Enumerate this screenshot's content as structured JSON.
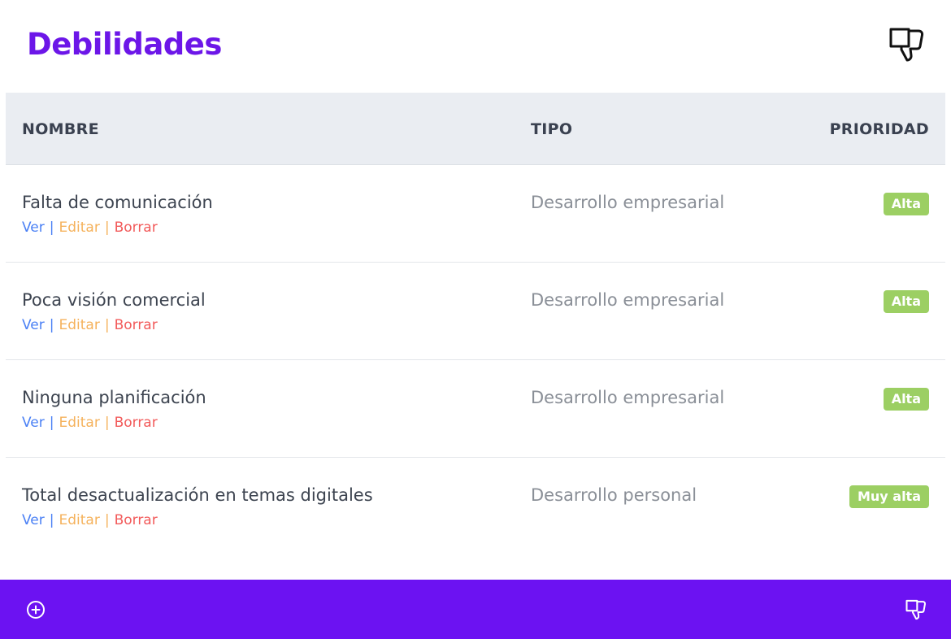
{
  "panel": {
    "title": "Debilidades",
    "header_icon": "thumbs-down-icon"
  },
  "table": {
    "columns": {
      "name": "NOMBRE",
      "type": "TIPO",
      "priority": "PRIORIDAD"
    },
    "rows": [
      {
        "name": "Falta de comunicación",
        "type": "Desarrollo empresarial",
        "priority": "Alta"
      },
      {
        "name": "Poca visión comercial",
        "type": "Desarrollo empresarial",
        "priority": "Alta"
      },
      {
        "name": "Ninguna planificación",
        "type": "Desarrollo empresarial",
        "priority": "Alta"
      },
      {
        "name": "Total desactualización en temas digitales",
        "type": "Desarrollo personal",
        "priority": "Muy alta"
      }
    ],
    "actions": {
      "view": "Ver",
      "edit": "Editar",
      "delete": "Borrar",
      "separator": "|"
    }
  },
  "footer": {
    "add_icon": "plus-circle-icon",
    "thumb_icon": "thumbs-down-icon"
  },
  "colors": {
    "accent": "#6c16e8",
    "footer_bg": "#6c12f2",
    "header_row_bg": "#eaedf2",
    "view_link": "#4a80f5",
    "edit_link": "#f5b25c",
    "delete_link": "#f25a5a",
    "priority_badge": "#9ccf63"
  }
}
